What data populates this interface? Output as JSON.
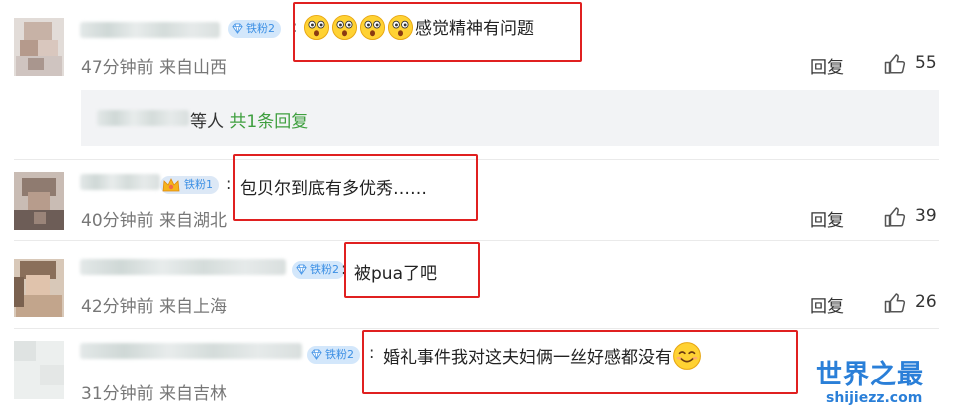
{
  "comments": [
    {
      "badge": "铁粉2",
      "text": "感觉精神有问题",
      "emoji_count": 4,
      "time": "47分钟前",
      "location": "来自山西",
      "reply_label": "回复",
      "likes": "55"
    },
    {
      "badge": "铁粉1",
      "text": "包贝尔到底有多优秀……",
      "time": "40分钟前",
      "location": "来自湖北",
      "reply_label": "回复",
      "likes": "39"
    },
    {
      "badge": "铁粉2",
      "text": "被pua了吧",
      "time": "42分钟前",
      "location": "来自上海",
      "reply_label": "回复",
      "likes": "26"
    },
    {
      "badge": "铁粉2",
      "text": "婚礼事件我对这夫妇俩一丝好感都没有",
      "time": "31分钟前",
      "location": "来自吉林"
    }
  ],
  "sub_replies": {
    "others_label": "等人",
    "total_label": "共1条回复"
  },
  "watermark": {
    "title": "世界之最",
    "url": "shijiezz.com"
  },
  "icons": {
    "like": "thumbs-up-icon",
    "badge": "diamond-icon",
    "emoji": "surprised-face-icon",
    "smile": "smile-face-icon"
  },
  "colors": {
    "highlight_border": "#e02020",
    "link_green": "#3f9f3f",
    "badge_blue": "#3b8fe4",
    "watermark_blue": "#2a7fd8"
  }
}
